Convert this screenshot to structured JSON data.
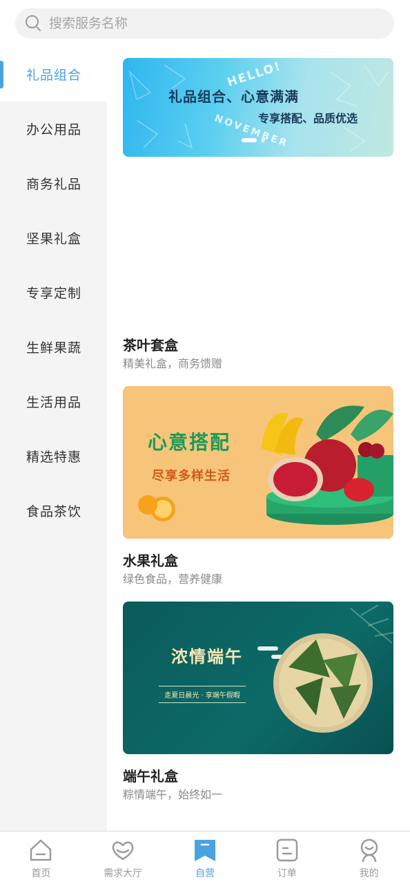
{
  "search": {
    "placeholder": "搜索服务名称"
  },
  "sidebar": {
    "items": [
      {
        "label": "礼品组合",
        "active": true
      },
      {
        "label": "办公用品",
        "active": false
      },
      {
        "label": "商务礼品",
        "active": false
      },
      {
        "label": "坚果礼盒",
        "active": false
      },
      {
        "label": "专享定制",
        "active": false
      },
      {
        "label": "生鲜果蔬",
        "active": false
      },
      {
        "label": "生活用品",
        "active": false
      },
      {
        "label": "精选特惠",
        "active": false
      },
      {
        "label": "食品茶饮",
        "active": false
      }
    ]
  },
  "banner": {
    "title": "礼品组合、心意满满",
    "subtitle": "专享搭配、品质优选",
    "hello": "HELLO!",
    "november": "NOVEMBER",
    "slide_count": 2,
    "active_slide": 1
  },
  "products": [
    {
      "name": "茶叶套盒",
      "desc": "精美礼盒，商务馈赠"
    },
    {
      "name": "水果礼盒",
      "desc": "绿色食品，营养健康",
      "image": {
        "title": "心意搭配",
        "subtitle": "尽享多样生活"
      }
    },
    {
      "name": "端午礼盒",
      "desc": "粽情端午，始终如一",
      "image": {
        "title": "浓情端午",
        "subtitle": "走夏日晨光 · 享端午假暇"
      }
    }
  ],
  "tabbar": {
    "items": [
      {
        "label": "首页",
        "icon": "home-icon",
        "active": false
      },
      {
        "label": "需求大厅",
        "icon": "heart-hands-icon",
        "active": false
      },
      {
        "label": "自营",
        "icon": "bookmark-icon",
        "active": true
      },
      {
        "label": "订单",
        "icon": "order-icon",
        "active": false
      },
      {
        "label": "我的",
        "icon": "user-icon",
        "active": false
      }
    ]
  },
  "colors": {
    "accent": "#4aa3e0",
    "sidebar_bg": "#f4f4f4",
    "inactive": "#9a9a9a"
  }
}
